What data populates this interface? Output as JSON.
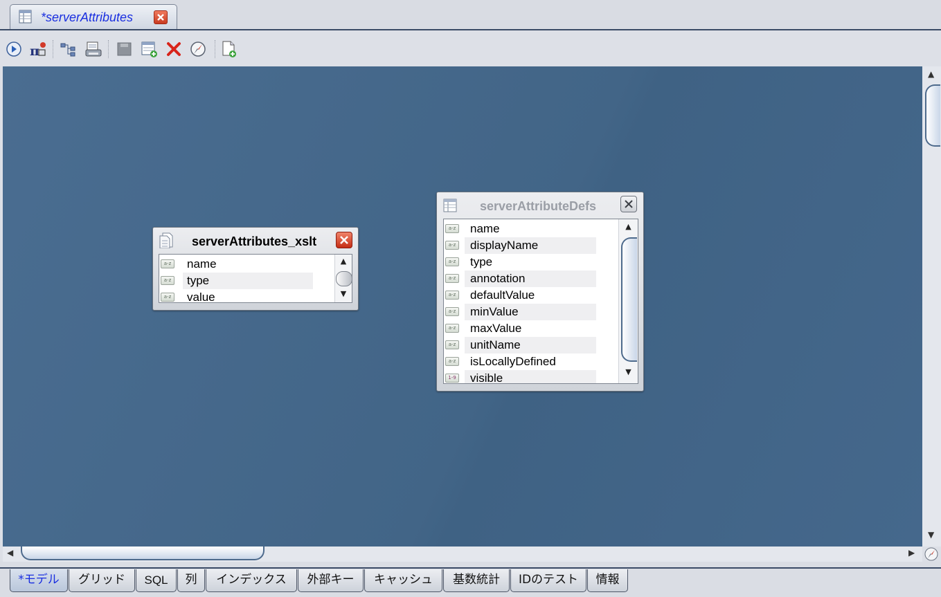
{
  "document": {
    "tab_title": "*serverAttributes",
    "tab_icon": "table-icon"
  },
  "toolbar": {
    "buttons": [
      {
        "id": "run",
        "icon": "play-circle-icon"
      },
      {
        "id": "function",
        "icon": "pi-function-icon"
      },
      {
        "id": "relations",
        "icon": "tree-relation-icon"
      },
      {
        "id": "print",
        "icon": "printer-icon"
      },
      {
        "id": "save",
        "icon": "save-disabled-icon"
      },
      {
        "id": "add-table",
        "icon": "add-table-icon"
      },
      {
        "id": "delete",
        "icon": "delete-x-icon"
      },
      {
        "id": "navigate",
        "icon": "compass-icon"
      },
      {
        "id": "new-document",
        "icon": "new-document-icon"
      }
    ]
  },
  "tables": [
    {
      "title": "serverAttributes_xslt",
      "active": true,
      "fields": [
        {
          "name": "name",
          "type": "a-z"
        },
        {
          "name": "type",
          "type": "a-z"
        },
        {
          "name": "value",
          "type": "a-z"
        }
      ]
    },
    {
      "title": "serverAttributeDefs",
      "active": false,
      "fields": [
        {
          "name": "name",
          "type": "a-z"
        },
        {
          "name": "displayName",
          "type": "a-z"
        },
        {
          "name": "type",
          "type": "a-z"
        },
        {
          "name": "annotation",
          "type": "a-z"
        },
        {
          "name": "defaultValue",
          "type": "a-z"
        },
        {
          "name": "minValue",
          "type": "a-z"
        },
        {
          "name": "maxValue",
          "type": "a-z"
        },
        {
          "name": "unitName",
          "type": "a-z"
        },
        {
          "name": "isLocallyDefined",
          "type": "a-z"
        },
        {
          "name": "visible",
          "type": "1-9"
        }
      ]
    }
  ],
  "view_tabs": [
    {
      "label": "*モデル",
      "active": true
    },
    {
      "label": "グリッド",
      "active": false
    },
    {
      "label": "SQL",
      "active": false
    },
    {
      "label": "列",
      "active": false
    },
    {
      "label": "インデックス",
      "active": false
    },
    {
      "label": "外部キー",
      "active": false
    },
    {
      "label": "キャッシュ",
      "active": false
    },
    {
      "label": "基数統計",
      "active": false
    },
    {
      "label": "IDのテスト",
      "active": false
    },
    {
      "label": "情報",
      "active": false
    }
  ],
  "colors": {
    "canvas": "#45688c",
    "accent_text": "#1a2fe0",
    "close_red": "#c52d14"
  }
}
